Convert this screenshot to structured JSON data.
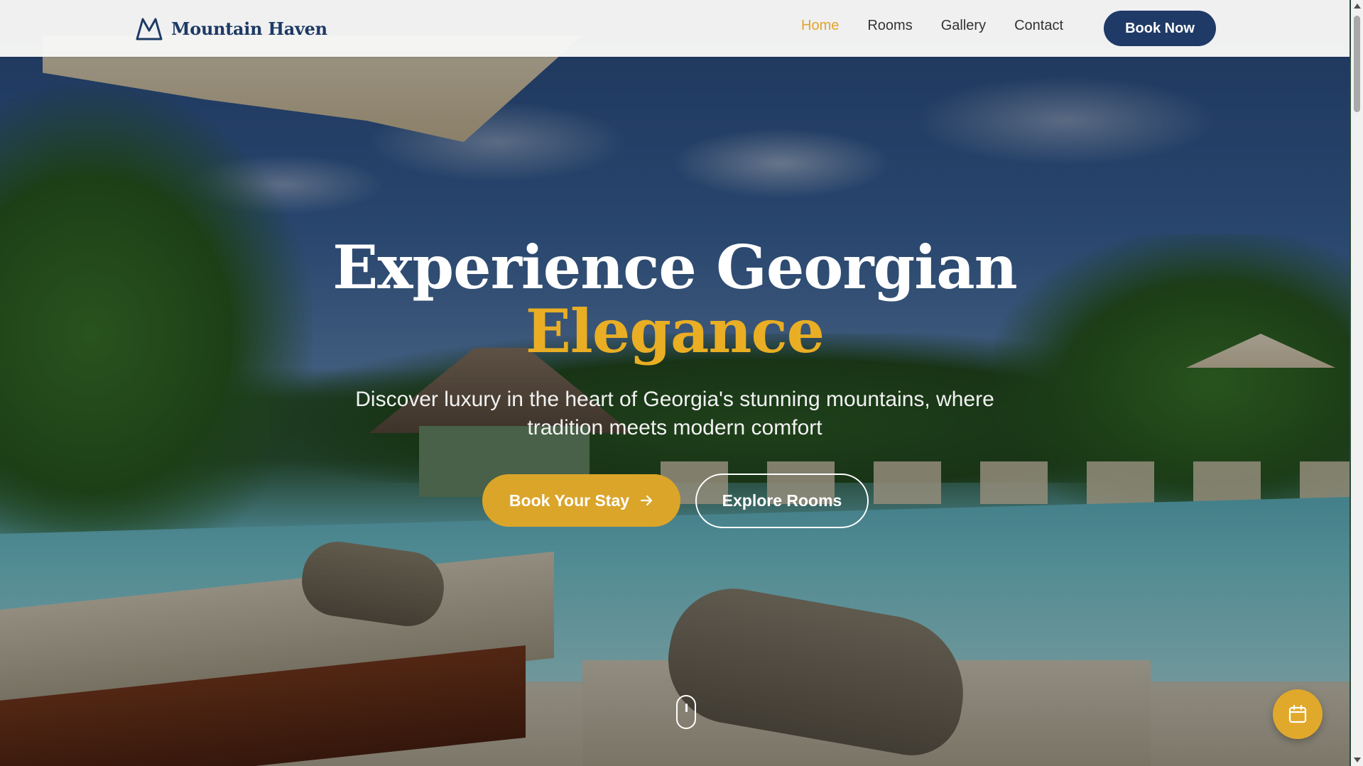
{
  "brand": {
    "name": "Mountain Haven",
    "logo_icon": "mountain-icon",
    "color": "#1e3a64"
  },
  "nav": {
    "items": [
      {
        "label": "Home",
        "active": true
      },
      {
        "label": "Rooms",
        "active": false
      },
      {
        "label": "Gallery",
        "active": false
      },
      {
        "label": "Contact",
        "active": false
      }
    ],
    "cta_label": "Book Now"
  },
  "hero": {
    "title_line1": "Experience Georgian",
    "title_line2": "Elegance",
    "subtitle": "Discover luxury in the heart of Georgia's stunning mountains, where tradition meets modern comfort",
    "primary_button": "Book Your Stay",
    "secondary_button": "Explore Rooms",
    "primary_button_icon": "arrow-right-icon",
    "scroll_icon": "mouse-scroll-icon"
  },
  "floating_button": {
    "icon": "calendar-icon"
  },
  "colors": {
    "accent": "#e2a52a",
    "navy": "#1f3a66",
    "header_bg": "#f7f7f6"
  }
}
